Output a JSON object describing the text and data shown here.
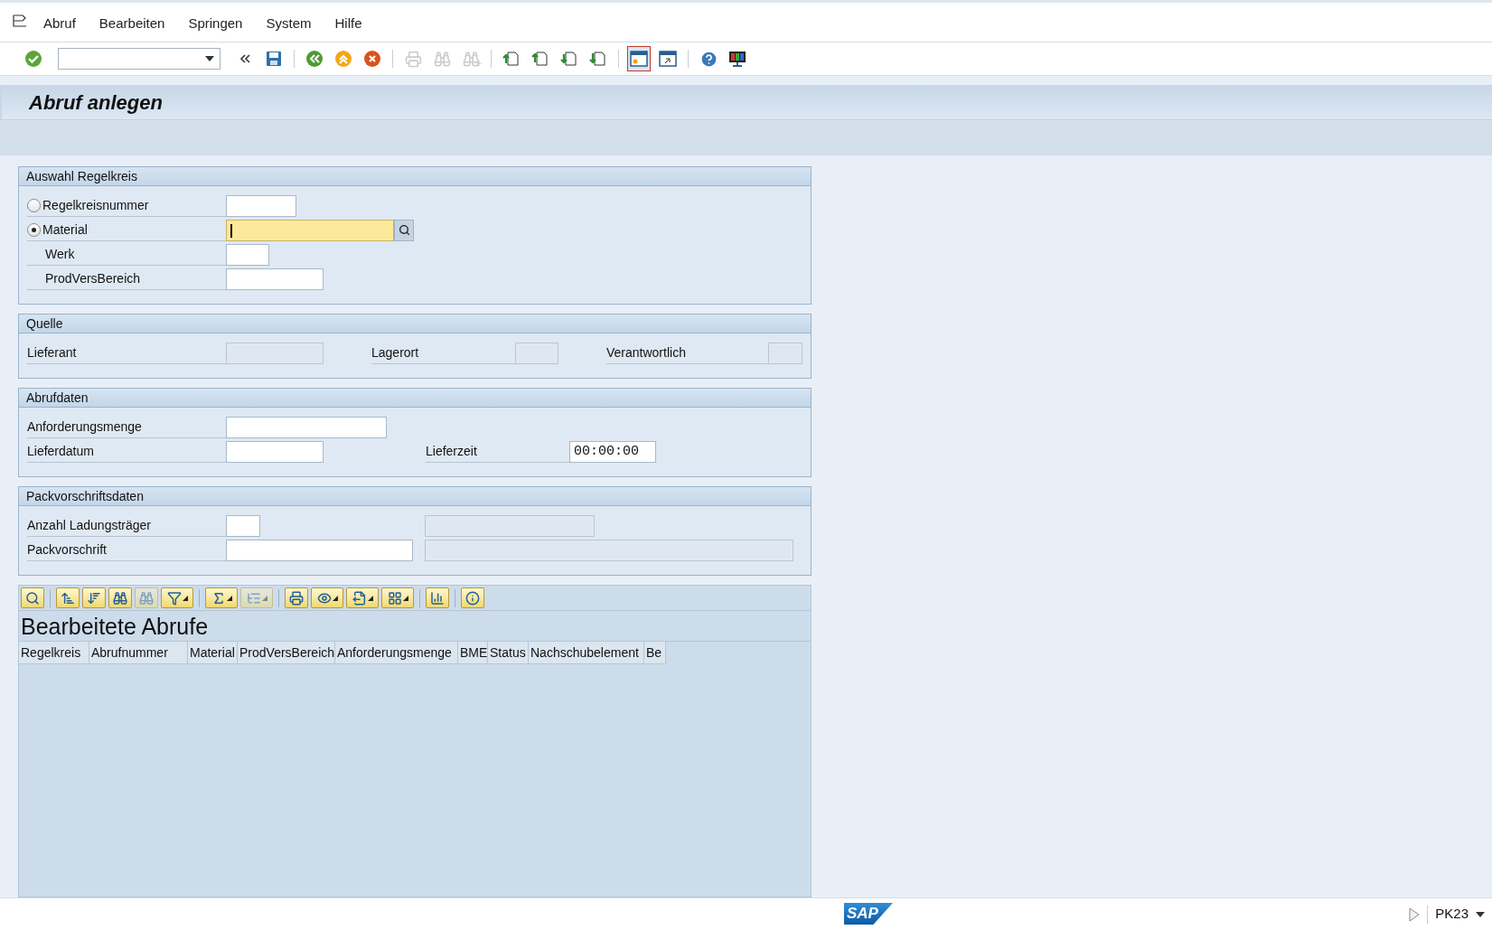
{
  "menu_bar": {
    "items": [
      {
        "label": "Abruf"
      },
      {
        "label": "Bearbeiten"
      },
      {
        "label": "Springen"
      },
      {
        "label": "System"
      },
      {
        "label": "Hilfe"
      }
    ]
  },
  "toolbar": {
    "buttons": [
      {
        "disabled": false
      },
      {
        "disabled": false,
        "focused": false
      },
      {
        "disabled": false,
        "focused": false
      },
      {
        "disabled": false,
        "focused": false
      },
      {
        "disabled": false,
        "focused": false
      },
      {
        "disabled": false,
        "focused": false
      },
      {
        "disabled": true,
        "focused": false
      },
      {
        "disabled": true,
        "focused": false
      },
      {
        "disabled": true,
        "focused": false
      },
      {
        "disabled": false,
        "focused": false
      },
      {
        "disabled": false,
        "focused": false
      },
      {
        "disabled": false,
        "focused": false
      },
      {
        "disabled": false,
        "focused": false
      },
      {
        "disabled": false,
        "focused": true
      },
      {
        "disabled": false,
        "focused": false
      },
      {
        "disabled": false,
        "focused": false
      },
      {
        "disabled": false,
        "focused": false
      }
    ]
  },
  "title": "Abruf anlegen",
  "groups": [
    {
      "title": "Auswahl Regelkreis",
      "rows": [
        {
          "kind": "radio",
          "selected": false,
          "cells": [
            {
              "label": "Regelkreisnummer",
              "field": {
                "disabled": false,
                "focused": false
              }
            }
          ]
        },
        {
          "kind": "radio",
          "selected": true,
          "cells": [
            {
              "label": "Material",
              "field": {
                "disabled": false,
                "focused": true,
                "search_help": true
              }
            }
          ]
        },
        {
          "kind": "indented",
          "cells": [
            {
              "label": "Werk",
              "field": {
                "disabled": false,
                "focused": false
              }
            }
          ]
        },
        {
          "kind": "indented",
          "cells": [
            {
              "label": "ProdVersBereich",
              "field": {
                "disabled": false,
                "focused": false
              }
            }
          ]
        }
      ]
    },
    {
      "title": "Quelle",
      "rows": [
        {
          "kind": "plain",
          "cells": [
            {
              "label": "Lieferant",
              "field": {
                "disabled": true,
                "focused": false
              }
            },
            {
              "label": "Lagerort",
              "field": {
                "disabled": true,
                "focused": false
              }
            },
            {
              "label": "Verantwortlich",
              "field": {
                "disabled": true,
                "focused": false
              }
            }
          ]
        }
      ]
    },
    {
      "title": "Abrufdaten",
      "rows": [
        {
          "kind": "plain",
          "cells": [
            {
              "label": "Anforderungsmenge",
              "field": {
                "disabled": false,
                "focused": false
              }
            }
          ]
        },
        {
          "kind": "plain",
          "cells": [
            {
              "label": "Lieferdatum",
              "field": {
                "disabled": false,
                "focused": false
              }
            },
            {
              "label": "Lieferzeit",
              "field": {
                "disabled": false,
                "focused": false,
                "value": "00:00:00"
              }
            }
          ]
        }
      ]
    },
    {
      "title": "Packvorschriftsdaten",
      "rows": [
        {
          "kind": "plain",
          "cells": [
            {
              "label": "Anzahl Ladungsträger",
              "field": {
                "disabled": false,
                "focused": false
              }
            },
            {
              "field": {
                "disabled": true,
                "focused": false
              }
            }
          ]
        },
        {
          "kind": "plain",
          "cells": [
            {
              "label": "Packvorschrift",
              "field": {
                "disabled": false,
                "focused": false
              }
            },
            {
              "field": {
                "disabled": true,
                "focused": false
              }
            }
          ]
        }
      ]
    }
  ],
  "alv": {
    "toolbar": [
      {
        "disabled": false,
        "menu": false
      },
      {
        "disabled": false,
        "menu": false
      },
      {
        "disabled": false,
        "menu": false
      },
      {
        "disabled": false,
        "menu": false
      },
      {
        "disabled": true,
        "menu": false
      },
      {
        "disabled": false,
        "menu": true
      },
      {
        "disabled": false,
        "menu": true
      },
      {
        "disabled": true,
        "menu": true
      },
      {
        "disabled": false,
        "menu": false
      },
      {
        "disabled": false,
        "menu": true
      },
      {
        "disabled": false,
        "menu": true
      },
      {
        "disabled": false,
        "menu": true
      },
      {
        "disabled": false,
        "menu": false
      },
      {
        "disabled": false,
        "menu": false
      }
    ],
    "title": "Bearbeitete Abrufe",
    "columns": [
      "Regelkreis",
      "Abrufnummer",
      "Material",
      "ProdVersBereich",
      "Anforderungsmenge",
      "BME",
      "Status",
      "Nachschubelement",
      "Be"
    ]
  },
  "status_bar": {
    "logo": "SAP",
    "transaction": "PK23"
  }
}
